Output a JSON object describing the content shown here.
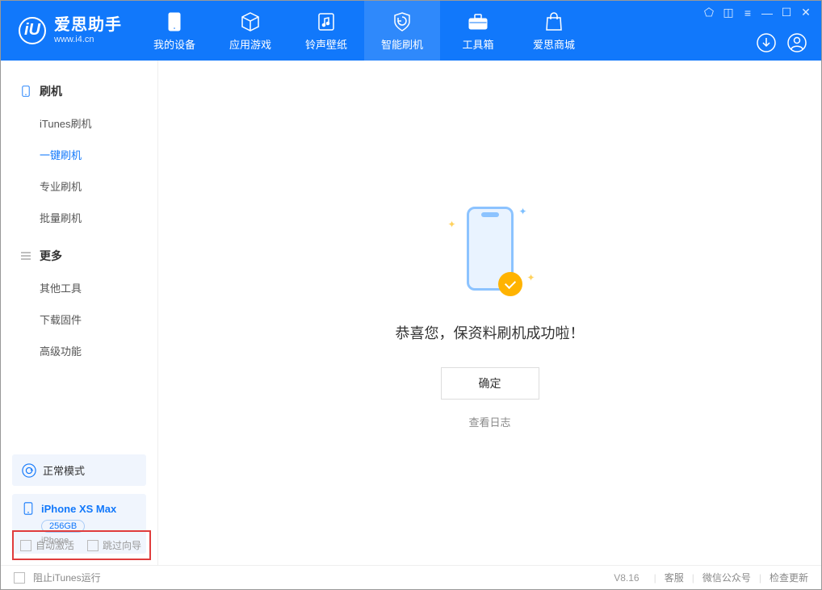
{
  "app": {
    "title": "爱思助手",
    "subtitle": "www.i4.cn"
  },
  "nav": {
    "device": "我的设备",
    "apps": "应用游戏",
    "ringtones": "铃声壁纸",
    "flash": "智能刷机",
    "toolbox": "工具箱",
    "store": "爱思商城"
  },
  "sidebar": {
    "section1": "刷机",
    "items1": {
      "itunes": "iTunes刷机",
      "oneclick": "一键刷机",
      "pro": "专业刷机",
      "batch": "批量刷机"
    },
    "section2": "更多",
    "items2": {
      "other": "其他工具",
      "firmware": "下载固件",
      "advanced": "高级功能"
    },
    "mode": "正常模式",
    "device_name": "iPhone XS Max",
    "device_storage": "256GB",
    "device_type": "iPhone",
    "auto_activate": "自动激活",
    "skip_guide": "跳过向导"
  },
  "main": {
    "success": "恭喜您，保资料刷机成功啦！",
    "ok": "确定",
    "log": "查看日志"
  },
  "footer": {
    "block_itunes": "阻止iTunes运行",
    "version": "V8.16",
    "service": "客服",
    "wechat": "微信公众号",
    "update": "检查更新"
  }
}
